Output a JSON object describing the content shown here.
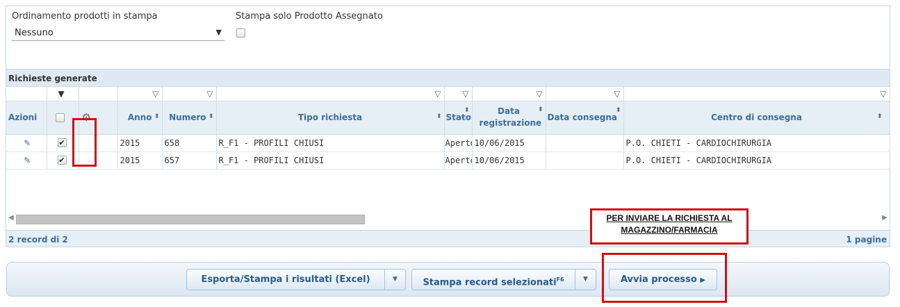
{
  "options": {
    "sort_label": "Ordinamento prodotti in stampa",
    "sort_value": "Nessuno",
    "assigned_label": "Stampa solo Prodotto Assegnato"
  },
  "section": {
    "title": "Richieste generate"
  },
  "table": {
    "headers": {
      "azioni": "Azioni",
      "anno": "Anno",
      "numero": "Numero",
      "tipo": "Tipo richiesta",
      "stato": "Stato",
      "data_reg": "Data registrazione",
      "data_cons": "Data consegna",
      "centro": "Centro di consegna"
    },
    "rows": [
      {
        "anno": "2015",
        "numero": "658",
        "tipo": "R_F1 - PROFILI CHIUSI",
        "stato": "Aperto",
        "data_reg": "10/06/2015",
        "data_cons": "",
        "centro": "P.O. CHIETI - CARDIOCHIRURGIA",
        "checked": true
      },
      {
        "anno": "2015",
        "numero": "657",
        "tipo": "R_F1 - PROFILI CHIUSI",
        "stato": "Aperto",
        "data_reg": "10/06/2015",
        "data_cons": "",
        "centro": "P.O. CHIETI - CARDIOCHIRURGIA",
        "checked": true
      }
    ]
  },
  "footer": {
    "records": "2 record di 2",
    "pages": "1 pagine"
  },
  "callout": {
    "line1": "PER INVIARE LA RICHIESTA AL",
    "line2": "MAGAZZINO/FARMACIA"
  },
  "buttons": {
    "export": "Esporta/Stampa i risultati (Excel)",
    "print_selected": "Stampa record selezionati",
    "print_selected_shortcut": "F6",
    "start": "Avvia processo"
  },
  "icons": {
    "filter": "filter-icon",
    "sort": "sort-icon",
    "edit": "pencil-icon",
    "gear": "gear-icon",
    "dropdown": "caret-down-icon",
    "play": "play-icon"
  },
  "colors": {
    "highlight": "#d01010",
    "header_text": "#3c6e9c",
    "header_bg": "#e6eef6"
  }
}
